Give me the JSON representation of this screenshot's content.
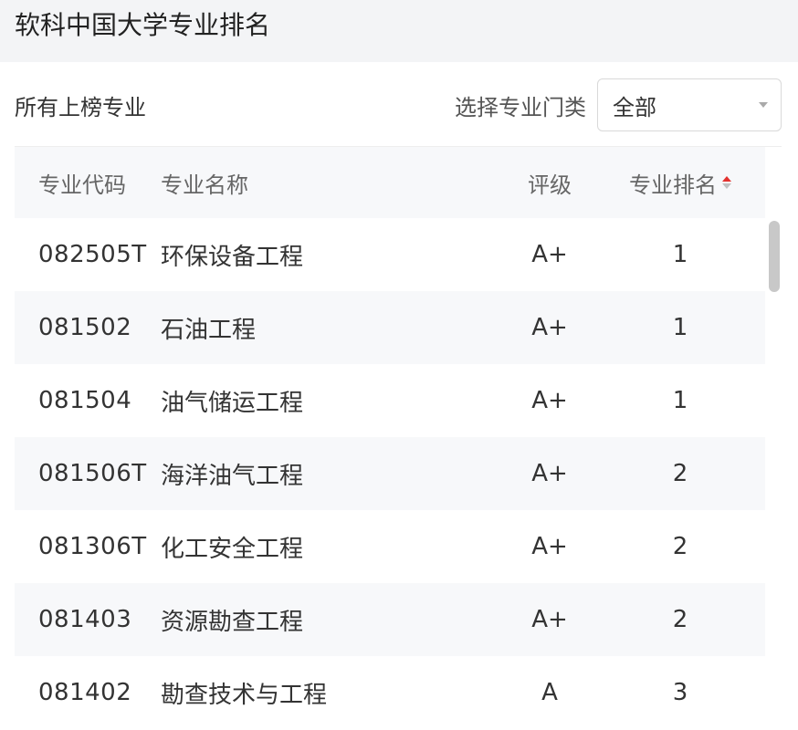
{
  "page": {
    "title": "软科中国大学专业排名"
  },
  "toolbar": {
    "label": "所有上榜专业",
    "filter_label": "选择专业门类",
    "filter_value": "全部"
  },
  "table": {
    "headers": {
      "code": "专业代码",
      "name": "专业名称",
      "grade": "评级",
      "rank": "专业排名"
    },
    "rows": [
      {
        "code": "082505T",
        "name": "环保设备工程",
        "grade": "A+",
        "rank": "1"
      },
      {
        "code": "081502",
        "name": "石油工程",
        "grade": "A+",
        "rank": "1"
      },
      {
        "code": "081504",
        "name": "油气储运工程",
        "grade": "A+",
        "rank": "1"
      },
      {
        "code": "081506T",
        "name": "海洋油气工程",
        "grade": "A+",
        "rank": "2"
      },
      {
        "code": "081306T",
        "name": "化工安全工程",
        "grade": "A+",
        "rank": "2"
      },
      {
        "code": "081403",
        "name": "资源勘查工程",
        "grade": "A+",
        "rank": "2"
      },
      {
        "code": "081402",
        "name": "勘查技术与工程",
        "grade": "A",
        "rank": "3"
      }
    ]
  },
  "icons": {
    "sort": "sort-icon",
    "dropdown": "chevron-down-icon"
  },
  "colors": {
    "sort_active": "#e3322f",
    "row_alt": "#f7f8fa"
  }
}
